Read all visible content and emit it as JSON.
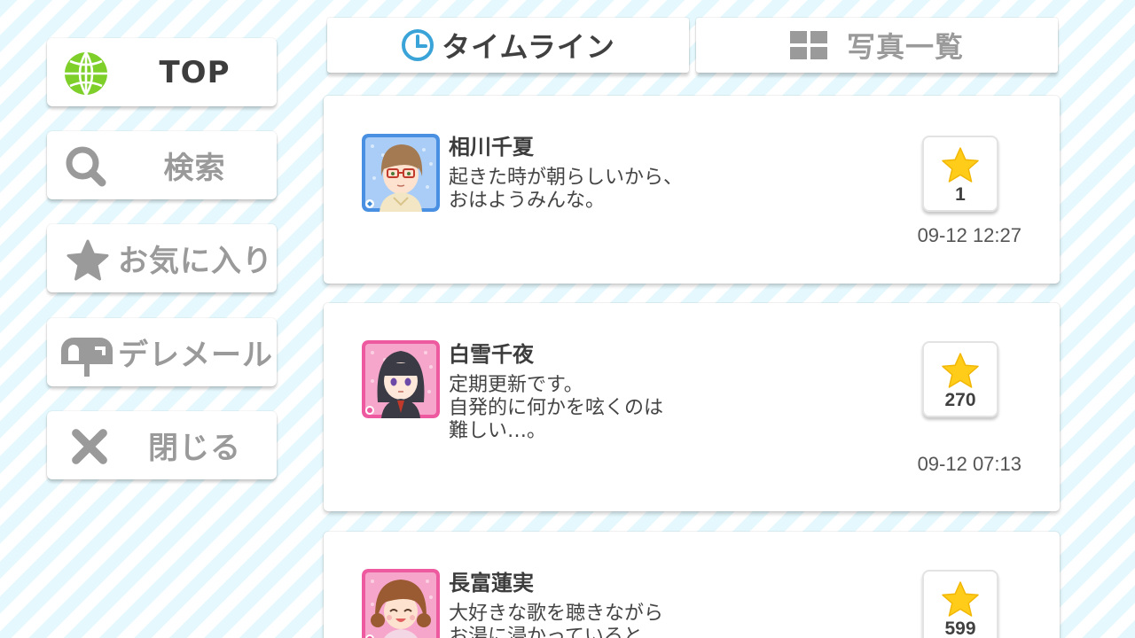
{
  "sidebar": {
    "items": [
      {
        "label": "TOP",
        "icon": "globe-icon",
        "active": true
      },
      {
        "label": "検索",
        "icon": "search-icon",
        "active": false
      },
      {
        "label": "お気に入り",
        "icon": "star-icon",
        "active": false
      },
      {
        "label": "デレメール",
        "icon": "mailbox-icon",
        "active": false
      },
      {
        "label": "閉じる",
        "icon": "close-icon",
        "active": false
      }
    ]
  },
  "tabs": [
    {
      "label": "タイムライン",
      "icon": "clock-icon",
      "selected": true
    },
    {
      "label": "写真一覧",
      "icon": "grid-icon",
      "selected": false
    }
  ],
  "posts": [
    {
      "name": "相川千夏",
      "lines": [
        "起きた時が朝らしいから、",
        "おはようみんな。"
      ],
      "favorites": "1",
      "time": "09-12 12:27",
      "avatar_frame": "blue"
    },
    {
      "name": "白雪千夜",
      "lines": [
        "定期更新です。",
        "自発的に何かを呟くのは",
        "難しい…。"
      ],
      "favorites": "270",
      "time": "09-12 07:13",
      "avatar_frame": "pink"
    },
    {
      "name": "長富蓮実",
      "lines": [
        "大好きな歌を聴きながら",
        "お湯に浸かっていると"
      ],
      "favorites": "599",
      "time": "",
      "avatar_frame": "pink"
    }
  ],
  "colors": {
    "stripe": "#e4f8fd",
    "accent_blue": "#3aa3d8",
    "star": "#ffcc1a",
    "frame_blue": "#4a90e2",
    "frame_pink": "#ee5aa0"
  }
}
